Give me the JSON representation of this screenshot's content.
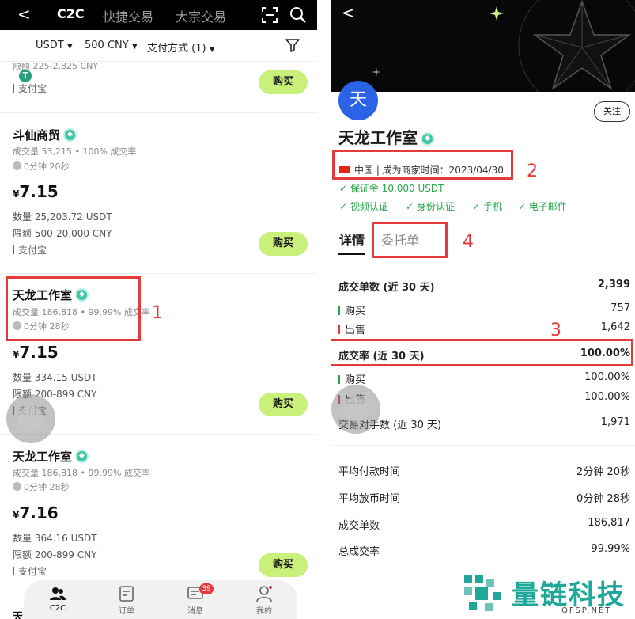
{
  "left": {
    "topbar": {
      "back": "<",
      "tabs": [
        "C2C",
        "快捷交易",
        "大宗交易"
      ]
    },
    "filters": {
      "coin": "USDT",
      "amount": "500 CNY",
      "payment": "支付方式 (1)"
    },
    "partial_top": {
      "limit": "限额 225-2,825 CNY",
      "pay": "支付宝",
      "buy": "购买"
    },
    "listings": [
      {
        "merchant": "斗仙商贸",
        "stats": "成交量 53,215 • 100% 成交率",
        "time": "0分钟 20秒",
        "currency": "¥",
        "price": "7.15",
        "qty": "数量 25,203.72 USDT",
        "limit": "限额 500-20,000 CNY",
        "pay": "支付宝",
        "buy": "购买"
      },
      {
        "merchant": "天龙工作室",
        "stats": "成交量 186,818 • 99.99% 成交率",
        "time": "0分钟 28秒",
        "currency": "¥",
        "price": "7.15",
        "qty": "数量 334.15 USDT",
        "limit": "限额 200-899 CNY",
        "pay": "支付宝",
        "buy": "购买"
      },
      {
        "merchant": "天龙工作室",
        "stats": "成交量 186,818 • 99.99% 成交率",
        "time": "0分钟 28秒",
        "currency": "¥",
        "price": "7.16",
        "qty": "数量 364.16 USDT",
        "limit": "限额 200-899 CNY",
        "pay": "支付宝",
        "buy": "购买"
      }
    ],
    "partial_bottom": "天",
    "annotation": "1",
    "nav": [
      {
        "label": "C2C",
        "icon": "c2c-users-icon"
      },
      {
        "label": "订单",
        "icon": "order-icon"
      },
      {
        "label": "消息",
        "icon": "message-icon",
        "badge": "39"
      },
      {
        "label": "我的",
        "icon": "profile-icon"
      }
    ]
  },
  "right": {
    "back": "<",
    "avatar_char": "天",
    "follow": "关注",
    "name": "天龙工作室",
    "meta": "中国 | 成为商家时间：2023/04/30",
    "deposit": "✓ 保证金 10,000 USDT",
    "verifications": [
      "✓ 视频认证",
      "✓ 身份认证",
      "✓ 手机",
      "✓ 电子邮件"
    ],
    "tabs": [
      "详情",
      "委托单"
    ],
    "annotations": [
      "2",
      "3",
      "4"
    ],
    "stats": {
      "orders_label": "成交单数 (近 30 天)",
      "orders_value": "2,399",
      "buy_label": "购买",
      "buy_value": "757",
      "sell_label": "出售",
      "sell_value": "1,642",
      "rate_label": "成交率 (近 30 天)",
      "rate_value": "100.00%",
      "rate_buy_label": "购买",
      "rate_buy_value": "100.00%",
      "rate_sell_label": "出售",
      "rate_sell_value": "100.00%",
      "counterparties_label": "交易对手数 (近 30 天)",
      "counterparties_value": "1,971",
      "avg_pay_label": "平均付款时间",
      "avg_pay_value": "2分钟 20秒",
      "avg_release_label": "平均放币时间",
      "avg_release_value": "0分钟 28秒",
      "total_orders_label": "成交单数",
      "total_orders_value": "186,817",
      "total_rate_label": "总成交率",
      "total_rate_value": "99.99%"
    },
    "watermark": {
      "title": "量链科技",
      "sub": "QFSP.NET"
    }
  },
  "colors": {
    "buy_button": "#c8f07a",
    "annotation_red": "#e33b3b",
    "avatar_blue": "#2b63e6",
    "verify_green": "#2aa74a",
    "watermark_teal": "#1fa89a"
  }
}
